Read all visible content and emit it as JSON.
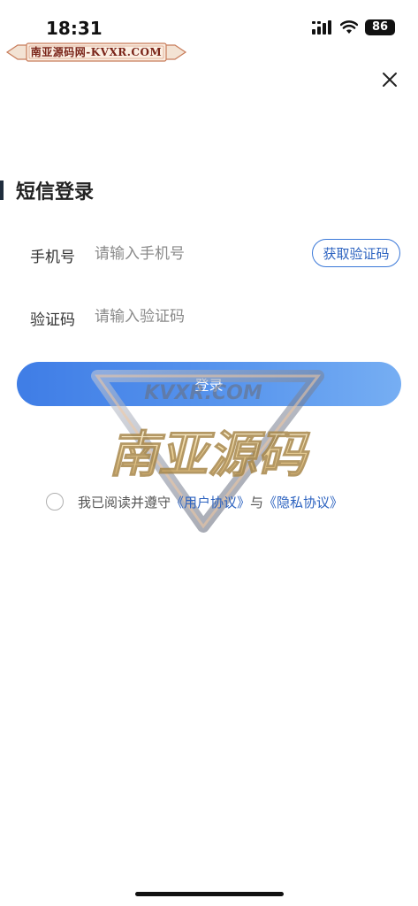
{
  "status_bar": {
    "time": "18:31",
    "battery": "86",
    "icons": [
      "cellular-signal-icon",
      "wifi-icon",
      "battery-icon"
    ]
  },
  "watermark_banner": {
    "text": "南亚源码网-KVXR.COM"
  },
  "header": {
    "close_icon": "close-icon",
    "title": "短信登录"
  },
  "form": {
    "phone": {
      "label": "手机号",
      "placeholder": "请输入手机号",
      "value": ""
    },
    "get_code_button": "获取验证码",
    "code": {
      "label": "验证码",
      "placeholder": "请输入验证码",
      "value": ""
    },
    "login_button": "登录"
  },
  "watermark_logo": {
    "top_text": "KVXR.COM",
    "main_text": "南亚源码"
  },
  "agreement": {
    "checked": false,
    "prefix": "我已阅读并遵守",
    "user_agreement": "《用户协议》",
    "conjunction": "与",
    "privacy_policy": "《隐私协议》"
  },
  "colors": {
    "accent": "#3f7de6",
    "link": "#2d63c0",
    "title": "#222222"
  }
}
